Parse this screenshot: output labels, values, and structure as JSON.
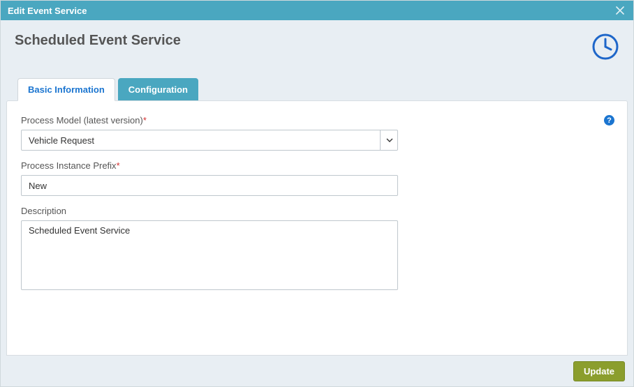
{
  "modal": {
    "title": "Edit Event Service"
  },
  "header": {
    "page_title": "Scheduled Event Service"
  },
  "tabs": {
    "basic_info": "Basic Information",
    "configuration": "Configuration"
  },
  "form": {
    "process_model": {
      "label": "Process Model (latest version)",
      "value": "Vehicle Request"
    },
    "instance_prefix": {
      "label": "Process Instance Prefix",
      "value": "New"
    },
    "description": {
      "label": "Description",
      "value": "Scheduled Event Service"
    }
  },
  "help_glyph": "?",
  "footer": {
    "update_label": "Update"
  }
}
